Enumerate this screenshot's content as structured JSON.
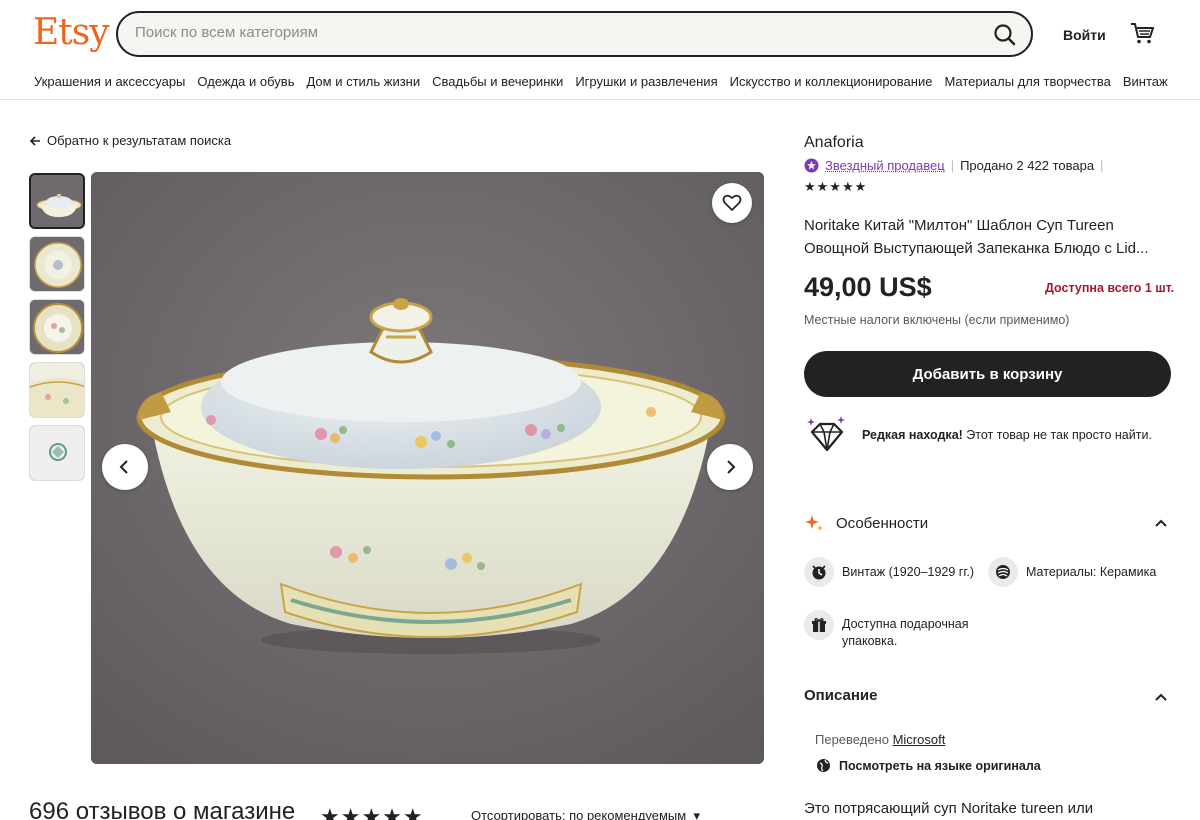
{
  "header": {
    "logo": "Etsy",
    "search_placeholder": "Поиск по всем категориям",
    "signin": "Войти"
  },
  "categories": [
    "Украшения и аксессуары",
    "Одежда и обувь",
    "Дом и стиль жизни",
    "Свадьбы и вечеринки",
    "Игрушки и развлечения",
    "Искусство и коллекционирование",
    "Материалы для творчества",
    "Винтаж"
  ],
  "back_link": "Обратно к результатам поиска",
  "gallery": {
    "thumb_count": 5,
    "active_index": 0
  },
  "reviews": {
    "title": "696 отзывов о магазине",
    "stars": "★★★★★",
    "sort": "Отсортировать: по рекомендуемым"
  },
  "product": {
    "shop": "Anaforia",
    "star_seller": "Звездный продавец",
    "sold": "Продано 2 422 товара",
    "shop_stars": "★★★★★",
    "title": "Noritake Китай \"Милтон\" Шаблон Суп Tureen Овощной Выступающей Запеканка Блюдо с Lid...",
    "price": "49,00 US$",
    "availability": "Доступна всего 1 шт.",
    "tax_note": "Местные налоги включены (если применимо)",
    "add_to_cart": "Добавить в корзину",
    "rare_bold": "Редкая находка!",
    "rare_text": " Этот товар не так просто найти."
  },
  "features": {
    "heading": "Особенности",
    "vintage": "Винтаж (1920–1929 гг.)",
    "materials": "Материалы: Керамика",
    "gift_line1": "Доступна подарочная",
    "gift_line2": "упаковка."
  },
  "description": {
    "heading": "Описание",
    "translated_prefix": "Переведено ",
    "translated_by": "Microsoft",
    "view_original": "Посмотреть на языке оригинала",
    "text": "Это потрясающий суп Noritake tureen или"
  },
  "colors": {
    "brand": "#f1641e",
    "star_seller": "#7f38b5",
    "availability": "#a61a2e",
    "button": "#222222"
  }
}
